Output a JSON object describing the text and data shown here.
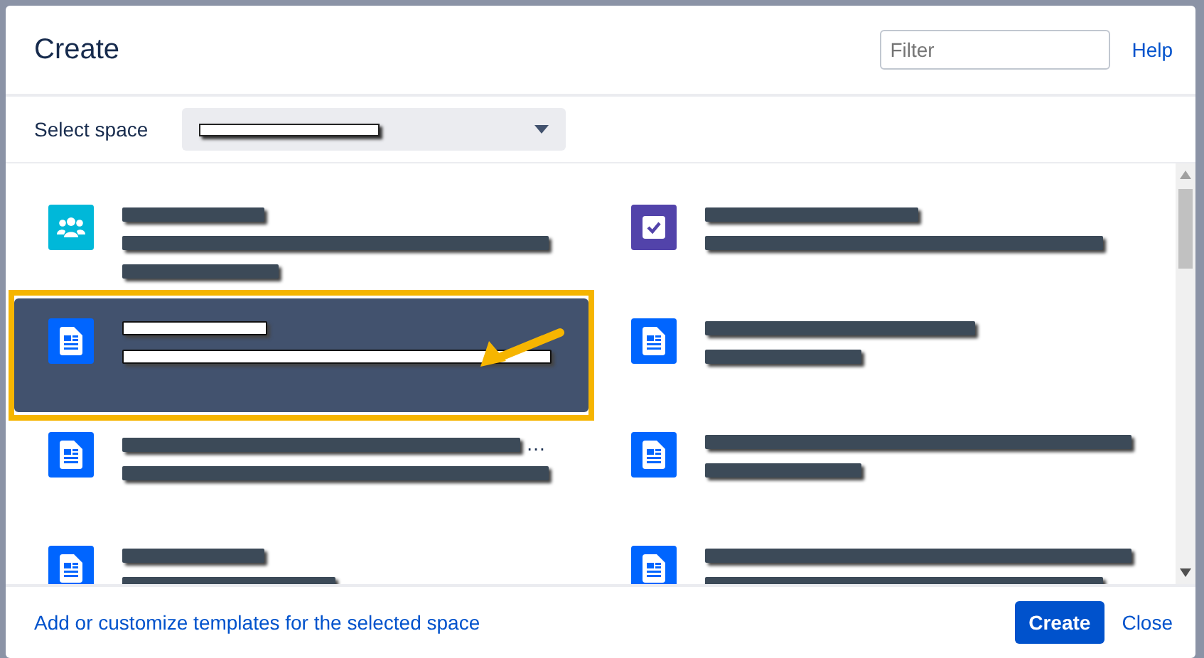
{
  "dialog": {
    "title": "Create",
    "filter": {
      "placeholder": "Filter"
    },
    "help": "Help"
  },
  "space_select": {
    "label": "Select space",
    "redacted": true
  },
  "templates": [
    {
      "kind": "people",
      "selected": false,
      "highlighted": false,
      "lines": [
        {
          "kind": "title"
        },
        {
          "kind": "long"
        },
        {
          "kind": "short"
        }
      ]
    },
    {
      "kind": "task",
      "selected": false,
      "highlighted": false,
      "lines": [
        {
          "kind": "short"
        },
        {
          "kind": "long"
        }
      ]
    },
    {
      "kind": "page",
      "selected": true,
      "highlighted": true,
      "lines": [
        {
          "kind": "title"
        },
        {
          "kind": "long"
        }
      ]
    },
    {
      "kind": "page",
      "selected": false,
      "highlighted": false,
      "lines": [
        {
          "kind": "title"
        },
        {
          "kind": "short"
        }
      ]
    },
    {
      "kind": "page",
      "selected": false,
      "highlighted": false,
      "lines": [
        {
          "kind": "long"
        },
        {
          "kind": "long"
        }
      ],
      "ellipsis": "…"
    },
    {
      "kind": "page",
      "selected": false,
      "highlighted": false,
      "lines": [
        {
          "kind": "long"
        },
        {
          "kind": "short"
        }
      ]
    },
    {
      "kind": "page",
      "selected": false,
      "highlighted": false,
      "lines": [
        {
          "kind": "title"
        },
        {
          "kind": "short"
        }
      ]
    },
    {
      "kind": "page",
      "selected": false,
      "highlighted": false,
      "lines": [
        {
          "kind": "long"
        },
        {
          "kind": "long"
        }
      ]
    }
  ],
  "footer": {
    "link": "Add or customize templates for the selected space",
    "primary": "Create",
    "secondary": "Close"
  }
}
